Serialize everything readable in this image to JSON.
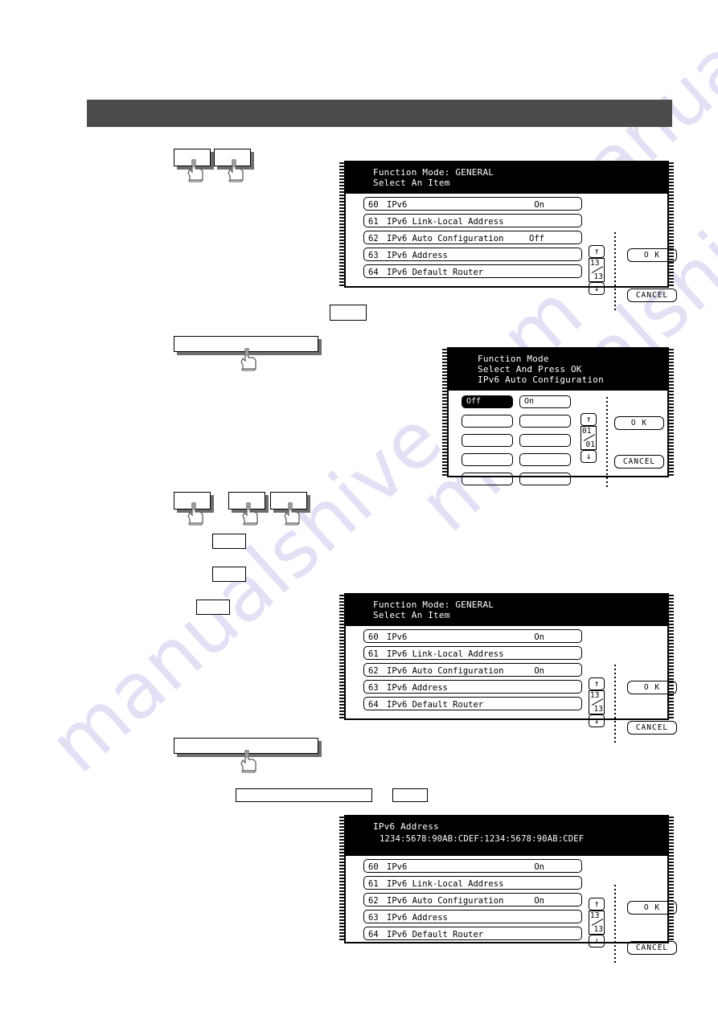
{
  "watermark": {
    "line1": "manualshive.com",
    "line2": "manualshive.com",
    "line3": "manualshive.com"
  },
  "panel1": {
    "title_line1": "Function Mode: GENERAL",
    "title_line2": "Select An Item",
    "rows": [
      {
        "num": "60",
        "label": "IPv6",
        "value": "On"
      },
      {
        "num": "61",
        "label": "IPv6 Link-Local Address",
        "value": ""
      },
      {
        "num": "62",
        "label": "IPv6 Auto Configuration",
        "value": "Off"
      },
      {
        "num": "63",
        "label": "IPv6 Address",
        "value": ""
      },
      {
        "num": "64",
        "label": "IPv6 Default Router",
        "value": ""
      }
    ],
    "scroll": {
      "up": "↑",
      "down": "↓",
      "current": "13",
      "total": "13"
    },
    "ok_label": "O K",
    "cancel_label": "CANCEL"
  },
  "panel2": {
    "title_line1": "Function Mode",
    "title_line2": "Select And Press OK",
    "title_line3": "IPv6 Auto Configuration",
    "choices": [
      {
        "label": "Off",
        "selected": true
      },
      {
        "label": "On",
        "selected": false
      },
      {
        "label": "",
        "selected": false
      },
      {
        "label": "",
        "selected": false
      },
      {
        "label": "",
        "selected": false
      },
      {
        "label": "",
        "selected": false
      },
      {
        "label": "",
        "selected": false
      },
      {
        "label": "",
        "selected": false
      },
      {
        "label": "",
        "selected": false
      },
      {
        "label": "",
        "selected": false
      }
    ],
    "scroll": {
      "up": "↑",
      "down": "↓",
      "current": "01",
      "total": "01"
    },
    "ok_label": "O K",
    "cancel_label": "CANCEL"
  },
  "panel3": {
    "title_line1": "Function Mode: GENERAL",
    "title_line2": "Select An Item",
    "rows": [
      {
        "num": "60",
        "label": "IPv6",
        "value": "On"
      },
      {
        "num": "61",
        "label": "IPv6 Link-Local Address",
        "value": ""
      },
      {
        "num": "62",
        "label": "IPv6 Auto Configuration",
        "value": "On"
      },
      {
        "num": "63",
        "label": "IPv6 Address",
        "value": ""
      },
      {
        "num": "64",
        "label": "IPv6 Default Router",
        "value": ""
      }
    ],
    "scroll": {
      "up": "↑",
      "down": "↓",
      "current": "13",
      "total": "13"
    },
    "ok_label": "O K",
    "cancel_label": "CANCEL"
  },
  "panel4": {
    "title_line1": "IPv6 Address",
    "address": "1234:5678:90AB:CDEF:1234:5678:90AB:CDEF",
    "rows": [
      {
        "num": "60",
        "label": "IPv6",
        "value": "On"
      },
      {
        "num": "61",
        "label": "IPv6 Link-Local Address",
        "value": ""
      },
      {
        "num": "62",
        "label": "IPv6 Auto Configuration",
        "value": "On"
      },
      {
        "num": "63",
        "label": "IPv6 Address",
        "value": ""
      },
      {
        "num": "64",
        "label": "IPv6 Default Router",
        "value": ""
      }
    ],
    "scroll": {
      "up": "↑",
      "down": "↓",
      "current": "13",
      "total": "13"
    },
    "ok_label": "O K",
    "cancel_label": "CANCEL"
  },
  "blanks": {
    "box_a": "",
    "box_b": "",
    "box_c": "",
    "box_d": "",
    "box_e": "",
    "box_f": "",
    "box_g": ""
  },
  "press_bars": {
    "bar_1": "",
    "bar_2": ""
  }
}
